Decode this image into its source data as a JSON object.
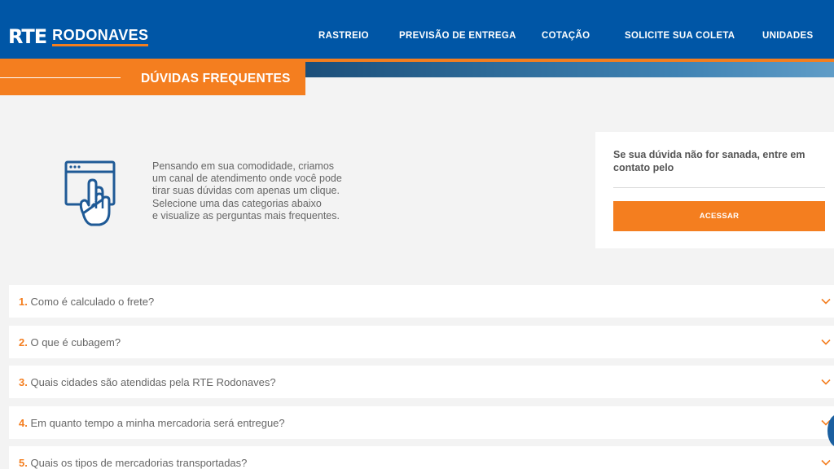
{
  "header": {
    "logo_rte": "RTE",
    "logo_name": "RODONAVES",
    "nav": [
      "RASTREIO",
      "PREVISÃO DE ENTREGA",
      "COTAÇÃO",
      "SOLICITE SUA COLETA",
      "UNIDADES"
    ]
  },
  "page": {
    "title": "DÚVIDAS FREQUENTES"
  },
  "intro": {
    "icon": "browser-hand-click-icon",
    "lines": [
      "Pensando em sua comodidade, criamos",
      "um canal de atendimento onde você pode",
      "tirar suas dúvidas com apenas um clique.",
      "Selecione uma das categorias abaixo",
      "e visualize as perguntas mais frequentes."
    ]
  },
  "contact": {
    "text": "Se sua dúvida não for sanada, entre em contato pelo",
    "button_label": "ACESSAR"
  },
  "faq": [
    {
      "num": "1.",
      "question": "Como é calculado o frete?"
    },
    {
      "num": "2.",
      "question": "O que é cubagem?"
    },
    {
      "num": "3.",
      "question": "Quais cidades são atendidas pela RTE Rodonaves?"
    },
    {
      "num": "4.",
      "question": "Em quanto tempo a minha mercadoria será entregue?"
    },
    {
      "num": "5.",
      "question": "Quais os tipos de mercadorias transportadas?"
    }
  ],
  "colors": {
    "brand_blue": "#0056a6",
    "accent_orange": "#f47e1f",
    "background": "#f3f3f3"
  }
}
